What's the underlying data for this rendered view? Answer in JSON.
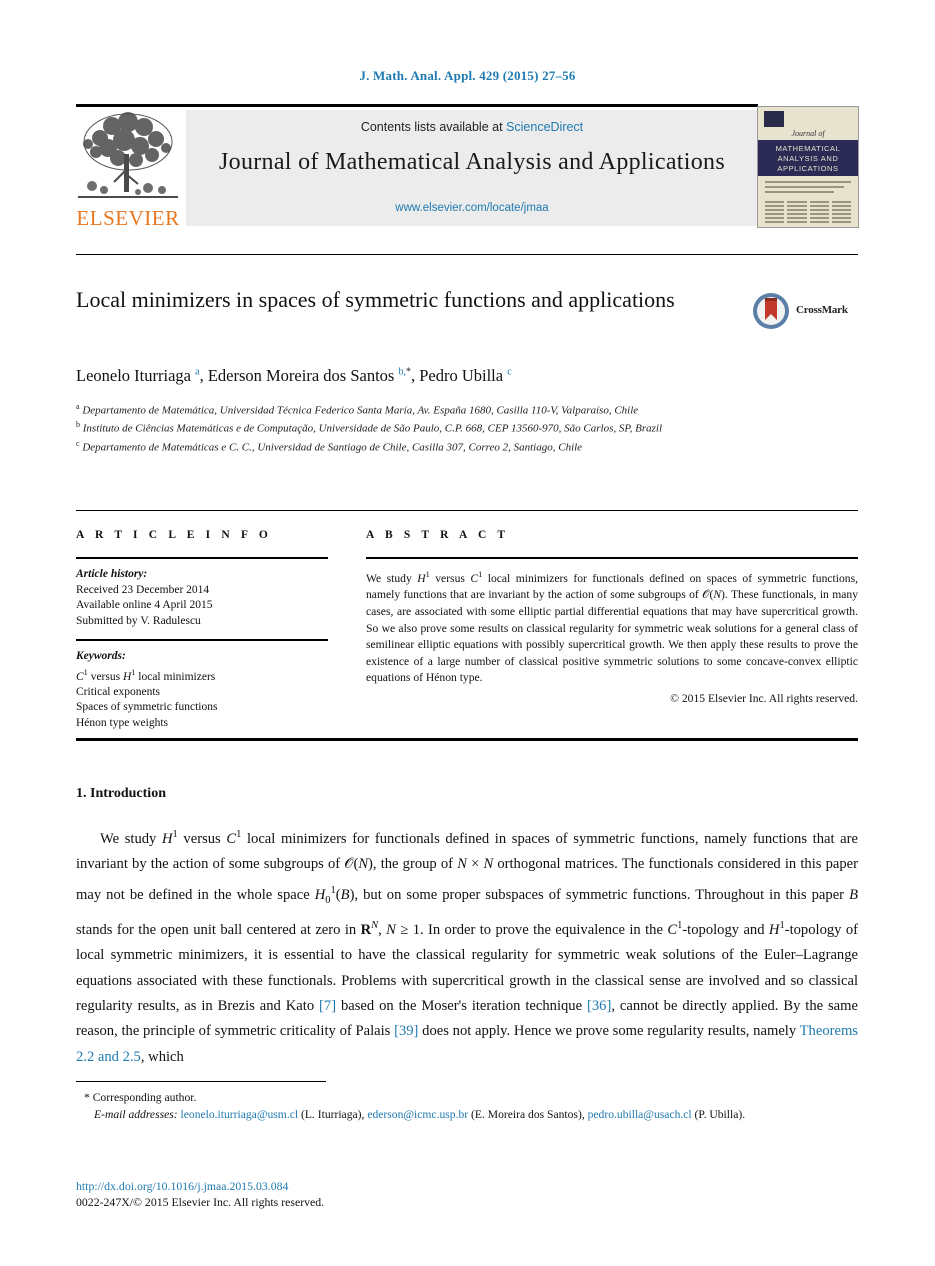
{
  "running_head": "J. Math. Anal. Appl. 429 (2015) 27–56",
  "masthead": {
    "contents_text": "Contents lists available at",
    "sciencedirect_label": "ScienceDirect",
    "journal_title": "Journal of Mathematical Analysis and Applications",
    "journal_url": "www.elsevier.com/locate/jmaa",
    "publisher_name": "ELSEVIER",
    "cover": {
      "journal_of": "Journal of",
      "band_line1": "MATHEMATICAL",
      "band_line2": "ANALYSIS AND",
      "band_line3": "APPLICATIONS"
    }
  },
  "article": {
    "title": "Local minimizers in spaces of symmetric functions and applications",
    "crossmark_label": "CrossMark",
    "authors_html": "Leonelo Iturriaga <sup>a</sup>, Ederson Moreira dos Santos <sup>b,</sup><sup class=\"star\">*</sup>, Pedro Ubilla <sup>c</sup>",
    "affiliations": [
      "Departamento de Matemática, Universidad Técnica Federico Santa María, Av. España 1680, Casilla 110-V, Valparaíso, Chile",
      "Instituto de Ciências Matemáticas e de Computação, Universidade de São Paulo, C.P. 668, CEP 13560-970, São Carlos, SP, Brazil",
      "Departamento de Matemáticas e C. C., Universidad de Santiago de Chile, Casilla 307, Correo 2, Santiago, Chile"
    ],
    "affiliation_marks": [
      "a",
      "b",
      "c"
    ]
  },
  "info": {
    "heading": "A R T I C L E   I N F O",
    "history_label": "Article history:",
    "history": [
      "Received 23 December 2014",
      "Available online 4 April 2015",
      "Submitted by V. Radulescu"
    ],
    "keywords_label": "Keywords:",
    "keywords_html": [
      "<span class=\"mathit\">C</span><sup class=\"m\">1</sup> versus <span class=\"mathit\">H</span><sup class=\"m\">1</sup> local minimizers",
      "Critical exponents",
      "Spaces of symmetric functions",
      "Hénon type weights"
    ]
  },
  "abstract": {
    "heading": "A B S T R A C T",
    "body_html": "We study <span class=\"mathit\">H</span><sup class=\"m\">1</sup> versus <span class=\"mathit\">C</span><sup class=\"m\">1</sup> local minimizers for functionals defined on spaces of symmetric functions, namely functions that are invariant by the action of some subgroups of &#119978;(<span class=\"mathit\">N</span>). These functionals, in many cases, are associated with some elliptic partial differential equations that may have supercritical growth. So we also prove some results on classical regularity for symmetric weak solutions for a general class of semilinear elliptic equations with possibly supercritical growth. We then apply these results to prove the existence of a large number of classical positive symmetric solutions to some concave-convex elliptic equations of Hénon type.",
    "copyright": "© 2015 Elsevier Inc. All rights reserved."
  },
  "section": {
    "heading": "1. Introduction",
    "paragraph_html": "We study <span class=\"mathit\">H</span><sup class=\"m\">1</sup> versus <span class=\"mathit\">C</span><sup class=\"m\">1</sup> local minimizers for functionals defined in spaces of symmetric functions, namely functions that are invariant by the action of some subgroups of &#119978;(<span class=\"mathit\">N</span>), the group of <span class=\"mathit\">N</span> × <span class=\"mathit\">N</span> orthogonal matrices. The functionals considered in this paper may not be defined in the whole space <span class=\"mathit\">H</span><sub class=\"m\">0</sub><sup class=\"m\">1</sup>(<span class=\"mathit\">B</span>), but on some proper subspaces of symmetric functions. Throughout in this paper <span class=\"mathit\">B</span> stands for the open unit ball centered at zero in <b>R</b><sup class=\"m\"><span class=\"mathit\">N</span></sup>, <span class=\"mathit\">N</span> ≥ 1. In order to prove the equivalence in the <span class=\"mathit\">C</span><sup class=\"m\">1</sup>-topology and <span class=\"mathit\">H</span><sup class=\"m\">1</sup>-topology of local symmetric minimizers, it is essential to have the classical regularity for symmetric weak solutions of the Euler–Lagrange equations associated with these functionals. Problems with supercritical growth in the classical sense are involved and so classical regularity results, as in Brezis and Kato <span class=\"ref\">[7]</span> based on the Moser's iteration technique <span class=\"ref\">[36]</span>, cannot be directly applied. By the same reason, the principle of symmetric criticality of Palais <span class=\"ref\">[39]</span> does not apply. Hence we prove some regularity results, namely <span class=\"ref\">Theorems 2.2 and 2.5</span>, which"
  },
  "footnotes": {
    "corresponding_author": "* Corresponding author.",
    "email_label": "E-mail addresses:",
    "emails_html": "<a class=\"mailto\" href=\"#\" data-name=\"email-link-iturriaga\" data-interactable=\"true\">leonelo.iturriaga@usm.cl</a> (L. Iturriaga), <a class=\"mailto\" href=\"#\" data-name=\"email-link-santos\" data-interactable=\"true\">ederson@icmc.usp.br</a> (E. Moreira dos Santos), <a class=\"mailto\" href=\"#\" data-name=\"email-link-ubilla\" data-interactable=\"true\">pedro.ubilla@usach.cl</a> (P. Ubilla)."
  },
  "doi": {
    "url": "http://dx.doi.org/10.1016/j.jmaa.2015.03.084",
    "issn_line": "0022-247X/© 2015 Elsevier Inc. All rights reserved."
  },
  "colors": {
    "link": "#1f7ab0",
    "elsevier_orange": "#E87722",
    "masthead_bg": "#ececec",
    "cover_bg": "#e8e3cf",
    "cover_band": "#2b2b55"
  }
}
